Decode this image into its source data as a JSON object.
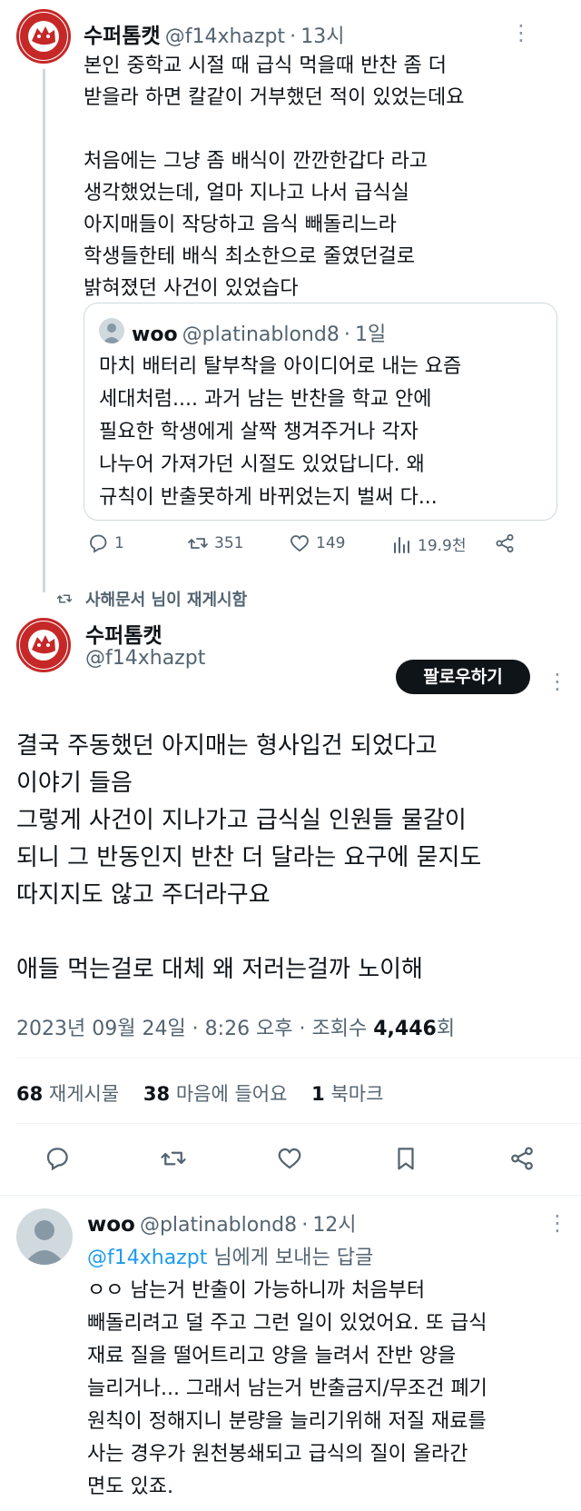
{
  "tweet1": {
    "name": "수퍼톰캣",
    "handle": "@f14xhazpt",
    "time": "13시",
    "lines": [
      "본인 중학교 시절 때 급식 먹을때 반찬 좀 더",
      "받을라 하면 칼같이 거부했던 적이 있었는데요",
      "",
      "처음에는 그냥 좀 배식이 깐깐한갑다 라고",
      "생각했었는데, 얼마 지나고 나서 급식실",
      "아지매들이 작당하고 음식 빼돌리느라",
      "학생들한테 배식 최소한으로 줄였던걸로",
      "밝혀졌던 사건이 있었습다"
    ],
    "quote": {
      "name": "woo",
      "handle": "@platinablond8",
      "time": "1일",
      "lines": [
        "마치 배터리 탈부착을 아이디어로 내는 요즘",
        "세대처럼.... 과거 남는 반찬을 학교 안에",
        "필요한 학생에게 살짝 챙겨주거나 각자",
        "나누어 가져가던 시절도 있었답니다. 왜",
        "규칙이 반출못하게 바뀌었는지 벌써 다..."
      ]
    },
    "actions": {
      "replies": "1",
      "retweets": "351",
      "likes": "149",
      "views": "19.9천"
    }
  },
  "retweet_banner": "사해문서 님이 재게시함",
  "main_tweet": {
    "name": "수퍼톰캣",
    "handle": "@f14xhazpt",
    "follow_label": "팔로우하기",
    "lines": [
      "결국 주동했던 아지매는 형사입건 되었다고",
      "이야기 들음",
      "그렇게 사건이 지나가고 급식실 인원들 물갈이",
      "되니 그 반동인지 반찬 더 달라는 요구에 묻지도",
      "따지지도 않고 주더라구요",
      "",
      "애들 먹는걸로 대체 왜 저러는걸까 노이해"
    ],
    "timestamp": "2023년 09월 24일 · 8:26 오후 · 조회수 ",
    "views_count": "4,446",
    "views_suffix": "회",
    "stats": {
      "retweets_count": "68",
      "retweets_label": "재게시물",
      "likes_count": "38",
      "likes_label": "마음에 들어요",
      "bookmarks_count": "1",
      "bookmarks_label": "북마크"
    }
  },
  "reply": {
    "name": "woo",
    "handle": "@platinablond8",
    "time": "12시",
    "reply_to_handle": "@f14xhazpt",
    "reply_to_suffix": " 님에게 보내는 답글",
    "lines": [
      "ㅇㅇ 남는거 반출이 가능하니까 처음부터",
      "빼돌리려고 덜 주고 그런 일이 있었어요. 또 급식",
      "재료 질을 떨어트리고 양을 늘려서 잔반 양을",
      "늘리거나... 그래서 남는거 반출금지/무조건 폐기",
      "원칙이 정해지니 분량을 늘리기위해 저질 재료를",
      "사는 경우가 원천봉쇄되고 급식의 질이 올라간",
      "면도 있죠."
    ]
  },
  "colors": {
    "accent": "#1d9bf0",
    "text": "#0f1419",
    "muted": "#536471",
    "logo_red": "#c62828"
  }
}
